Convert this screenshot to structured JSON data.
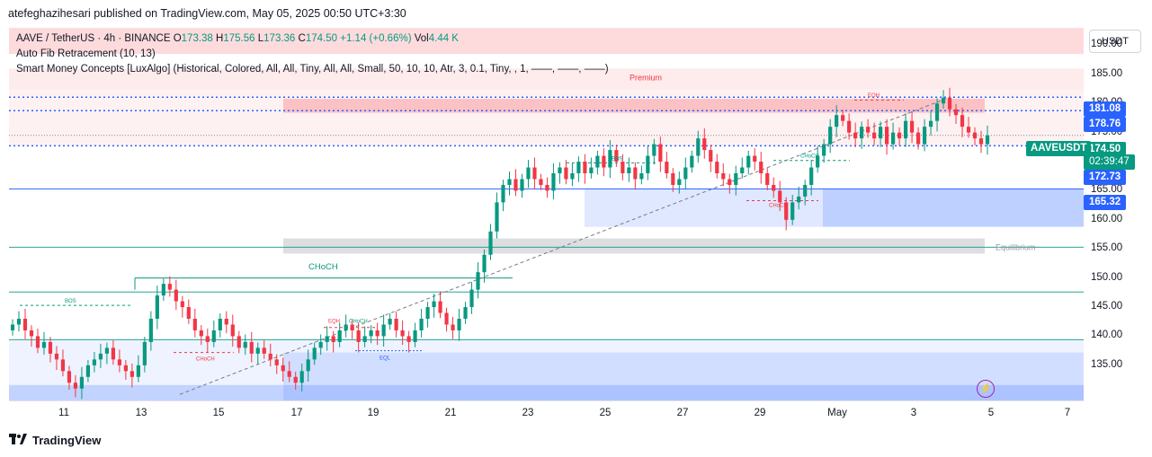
{
  "header": {
    "publisher_line": "atefeghazihesari published on TradingView.com, May 05, 2025 00:50 UTC+3:30"
  },
  "legend": {
    "symbol": "AAVE / TetherUS · 4h · BINANCE",
    "o_label": "O",
    "o_value": "173.38",
    "h_label": "H",
    "h_value": "175.56",
    "l_label": "L",
    "l_value": "173.36",
    "c_label": "C",
    "c_value": "174.50",
    "change": "+1.14 (+0.66%)",
    "vol_label": "Vol",
    "vol_value": "4.44 K",
    "indicator1": "Auto Fib Retracement (10, 13)",
    "indicator2": "Smart Money Concepts [LuxAlgo] (Historical, Colored, All, All, Tiny, All, All, Small, 50, 10, 10, Atr, 3, 0.1, Tiny, , 1, ——, ——, ——)"
  },
  "currency": "USDT",
  "footer": {
    "brand": "TradingView"
  },
  "price_tags": {
    "t181": "181.08",
    "t178": "178.76",
    "last": "174.50",
    "countdown": "02:39:47",
    "t172": "172.73",
    "t165": "165.32",
    "symbol": "AAVEUSDT"
  },
  "colors": {
    "up": "#089981",
    "down": "#f23645",
    "fib_blue": "#2962ff"
  },
  "chart_data": {
    "type": "candlestick",
    "ylim": [
      130,
      193
    ],
    "y_ticks": [
      "190.00",
      "185.00",
      "180.00",
      "175.00",
      "170.00",
      "165.00",
      "160.00",
      "155.00",
      "150.00",
      "145.00",
      "140.00",
      "135.00"
    ],
    "x_ticks": [
      "11",
      "13",
      "15",
      "17",
      "19",
      "21",
      "23",
      "25",
      "27",
      "29",
      "May",
      "3",
      "5",
      "7"
    ],
    "annotations": {
      "premium": "Premium",
      "equilibrium": "Equilibrium",
      "choch_big": "CHoCH",
      "choch_small": "CHoCH",
      "bos": "BOS",
      "eqh": "EQH",
      "eql": "EQL"
    },
    "closes": [
      142,
      143,
      141,
      140,
      138,
      139,
      137,
      136,
      134,
      132,
      131,
      133,
      135,
      136,
      137,
      138,
      136,
      135,
      134,
      133,
      135,
      139,
      143,
      147,
      149,
      148,
      146,
      145,
      143,
      141,
      140,
      139,
      141,
      143,
      142,
      140,
      138,
      139,
      137,
      138,
      137,
      136,
      135,
      134,
      133,
      132,
      134,
      136,
      138,
      139,
      140,
      139,
      141,
      142,
      141,
      139,
      140,
      141,
      140,
      142,
      143,
      141,
      140,
      139,
      141,
      143,
      145,
      146,
      144,
      142,
      141,
      143,
      145,
      148,
      151,
      154,
      158,
      163,
      166,
      167,
      165,
      167,
      169,
      167,
      166,
      165,
      168,
      169,
      167,
      168,
      170,
      168,
      169,
      171,
      169,
      172,
      170,
      168,
      169,
      167,
      168,
      171,
      173,
      170,
      168,
      166,
      167,
      169,
      171,
      174,
      172,
      170,
      168,
      167,
      166,
      168,
      169,
      171,
      170,
      168,
      166,
      165,
      163,
      160,
      163,
      164,
      166,
      169,
      171,
      173,
      176,
      178,
      177,
      175,
      174,
      176,
      175,
      174,
      176,
      173,
      175,
      174,
      177,
      175,
      173,
      176,
      177,
      180,
      181,
      179,
      178,
      176,
      175,
      174,
      173,
      174.5
    ]
  }
}
